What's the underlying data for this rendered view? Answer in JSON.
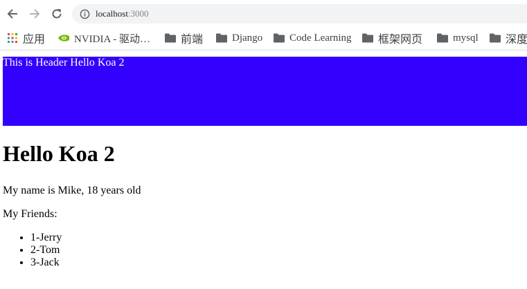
{
  "browser": {
    "nav": {
      "back_icon": "arrow-left-icon",
      "forward_icon": "arrow-right-icon",
      "reload_icon": "reload-icon"
    },
    "address_bar": {
      "host": "localhost",
      "port": ":3000",
      "info_icon": "info-circle-icon"
    },
    "bookmarks": [
      {
        "label": "应用",
        "icon": "apps-grid-icon"
      },
      {
        "label": "NVIDIA - 驱动…",
        "icon": "nvidia-logo-icon"
      },
      {
        "label": "前端",
        "icon": "folder-icon"
      },
      {
        "label": "Django",
        "icon": "folder-icon"
      },
      {
        "label": "Code Learning",
        "icon": "folder-icon"
      },
      {
        "label": "框架网页",
        "icon": "folder-icon"
      },
      {
        "label": "mysql",
        "icon": "folder-icon"
      },
      {
        "label": "深度",
        "icon": "folder-icon"
      }
    ]
  },
  "page": {
    "header_text": "This is Header Hello Koa 2",
    "header_color": "#3300ff",
    "title": "Hello Koa 2",
    "intro": "My name is Mike, 18 years old",
    "friends_label": "My Friends:",
    "friends": [
      "1-Jerry",
      "2-Tom",
      "3-Jack"
    ]
  }
}
